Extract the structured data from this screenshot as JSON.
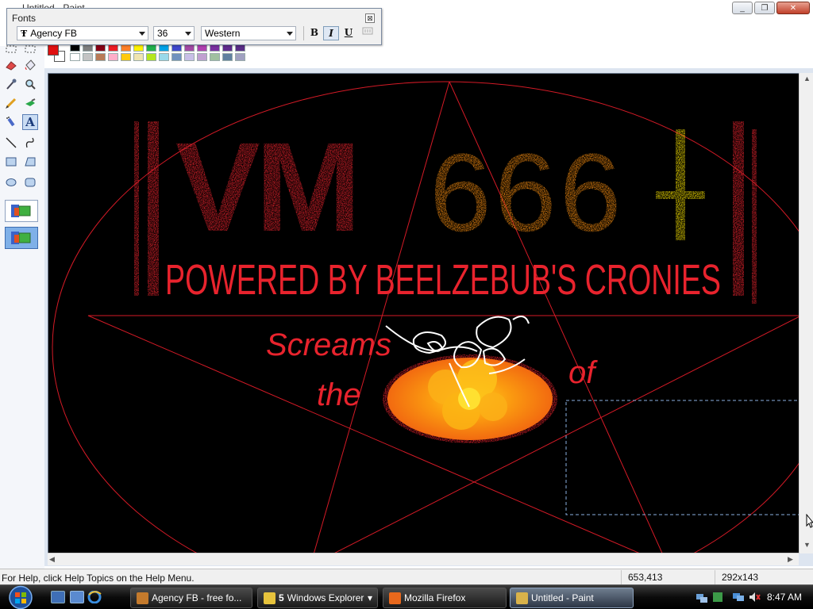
{
  "window": {
    "title": "Untitled - Paint",
    "minimize_glyph": "_",
    "maximize_glyph": "❐",
    "close_glyph": "✕"
  },
  "fonts_toolbar": {
    "title": "Fonts",
    "close_glyph": "⊠",
    "font_glyph": "Ŧ",
    "font_name": "Agency FB",
    "font_size": "36",
    "script": "Western",
    "bold_label": "B",
    "italic_label": "I",
    "underline_label": "U",
    "italic_pressed": true
  },
  "palette": {
    "foreground": "#e01010",
    "background": "#ffffff",
    "row1": [
      "#000000",
      "#7f7f7f",
      "#880015",
      "#ed1c24",
      "#ff7f27",
      "#fff200",
      "#22b14c",
      "#00a2e8",
      "#3f48cc",
      "#a349a4",
      "#b040b0",
      "#7a2fa0",
      "#602b8e",
      "#5a2c86"
    ],
    "row2": [
      "#ffffff",
      "#c3c3c3",
      "#b97a57",
      "#ffaec9",
      "#ffc90e",
      "#efe4b0",
      "#b5e61d",
      "#99d9ea",
      "#7092be",
      "#c8bfe7",
      "#c0a0d0",
      "#a0c0a0",
      "#6080a0",
      "#a0a0c0"
    ]
  },
  "tools": [
    {
      "name": "free-form-select-tool",
      "glyph": "⬚"
    },
    {
      "name": "select-tool",
      "glyph": "⬚"
    },
    {
      "name": "eraser-tool",
      "glyph": "▰"
    },
    {
      "name": "fill-tool",
      "glyph": "◆"
    },
    {
      "name": "pick-color-tool",
      "glyph": "✎"
    },
    {
      "name": "magnifier-tool",
      "glyph": "⌕"
    },
    {
      "name": "pencil-tool",
      "glyph": "✏"
    },
    {
      "name": "brush-tool",
      "glyph": "✦"
    },
    {
      "name": "airbrush-tool",
      "glyph": "✧"
    },
    {
      "name": "text-tool",
      "glyph": "A"
    },
    {
      "name": "line-tool",
      "glyph": "╲"
    },
    {
      "name": "curve-tool",
      "glyph": "∫"
    },
    {
      "name": "rectangle-tool",
      "glyph": "▭"
    },
    {
      "name": "polygon-tool",
      "glyph": "⏢"
    },
    {
      "name": "ellipse-tool",
      "glyph": "⬭"
    },
    {
      "name": "rounded-rectangle-tool",
      "glyph": "▢"
    }
  ],
  "canvas": {
    "art_title_left": "VM",
    "art_title_right": "666",
    "art_subtitle": "POWERED BY BEELZEBUB'S CRONIES",
    "art_word1": "Screams",
    "art_word2": "the",
    "art_word3": "of",
    "background_color": "#000000",
    "art_red": "#e8232d",
    "art_orange": "#f28a10",
    "art_yellow": "#f5e000"
  },
  "statusbar": {
    "help_text": "For Help, click Help Topics on the Help Menu.",
    "coordinates": "653,413",
    "selection_size": "292x143"
  },
  "taskbar": {
    "tasks": [
      {
        "label": "Agency FB - free fo...",
        "icon_color": "#c47a2c",
        "count": ""
      },
      {
        "label": "Windows Explorer",
        "icon_color": "#e7c33c",
        "count": "5"
      },
      {
        "label": "Mozilla Firefox",
        "icon_color": "#e8681c",
        "count": ""
      },
      {
        "label": "Untitled - Paint",
        "icon_color": "#d9b24a",
        "count": ""
      }
    ],
    "clock": "8:47 AM",
    "expand_glyph": "▾"
  }
}
